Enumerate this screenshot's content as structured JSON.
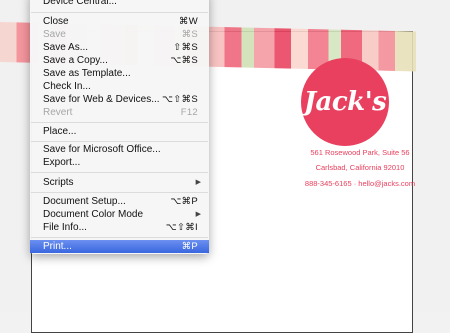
{
  "document": {
    "brand": "Jack's",
    "address_line1": "561 Rosewood Park, Suite 56",
    "address_line2": "Carlsbad, California 92010",
    "contact_line": "888-345-6165 · hello@jacks.com",
    "colors": {
      "brand_pink": "#e8405e"
    }
  },
  "file_menu": {
    "items": [
      {
        "label": "Device Central...",
        "shortcut": ""
      },
      {
        "label": "Close",
        "shortcut": "⌘W"
      },
      {
        "label": "Save",
        "shortcut": "⌘S",
        "disabled": true
      },
      {
        "label": "Save As...",
        "shortcut": "⇧⌘S"
      },
      {
        "label": "Save a Copy...",
        "shortcut": "⌥⌘S"
      },
      {
        "label": "Save as Template...",
        "shortcut": ""
      },
      {
        "label": "Check In...",
        "shortcut": ""
      },
      {
        "label": "Save for Web & Devices...",
        "shortcut": "⌥⇧⌘S"
      },
      {
        "label": "Revert",
        "shortcut": "F12",
        "disabled": true
      },
      {
        "label": "Place...",
        "shortcut": ""
      },
      {
        "label": "Save for Microsoft Office...",
        "shortcut": ""
      },
      {
        "label": "Export...",
        "shortcut": ""
      },
      {
        "label": "Scripts",
        "submenu": true
      },
      {
        "label": "Document Setup...",
        "shortcut": "⌥⌘P"
      },
      {
        "label": "Document Color Mode",
        "submenu": true
      },
      {
        "label": "File Info...",
        "shortcut": "⌥⇧⌘I"
      },
      {
        "label": "Print...",
        "shortcut": "⌘P",
        "highlighted": true
      }
    ],
    "highlight_color": "#3a67e0"
  }
}
